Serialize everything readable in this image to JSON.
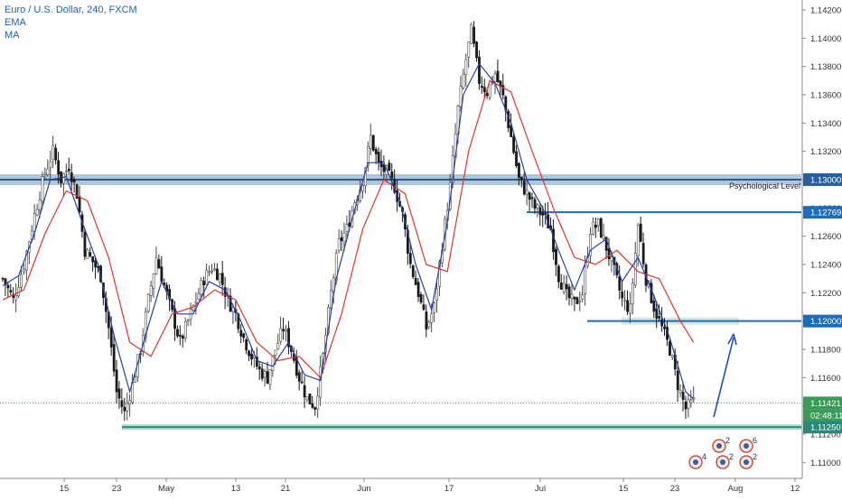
{
  "legend": {
    "symbol": "Euro / U.S. Dollar, 240, FXCM",
    "ema_label": "EMA",
    "ma_label": "MA"
  },
  "colors": {
    "candle_up": "#4a4a4a",
    "candle_down": "#1a1a1a",
    "ema_line": "#2a3ea8",
    "ma_line": "#e0362c",
    "resistance_band": "#1e5b99",
    "horizontal_line": "#1e6bb8",
    "support_band": "#2a8a7a",
    "zone_fill": "#cfe5dc",
    "arrow": "#1e4fb5",
    "price_dots": "#3a9a5a",
    "axis_text": "#333333"
  },
  "chart_data": {
    "type": "candlestick",
    "x_tick_labels": [
      "15",
      "23",
      "May",
      "13",
      "21",
      "Jun",
      "17",
      "Jul",
      "15",
      "23",
      "Aug",
      "12"
    ],
    "y_tick_labels": [
      "1.14200",
      "1.14000",
      "1.13800",
      "1.13600",
      "1.13400",
      "1.13200",
      "1.13000",
      "1.12800",
      "1.12600",
      "1.12400",
      "1.12200",
      "1.12000",
      "1.11800",
      "1.11600",
      "1.11400",
      "1.11200",
      "1.11000"
    ],
    "ylim": [
      1.109,
      1.1427
    ],
    "price_path": [
      [
        0,
        1.123
      ],
      [
        4,
        1.1215
      ],
      [
        8,
        1.124
      ],
      [
        12,
        1.1275
      ],
      [
        16,
        1.1305
      ],
      [
        19,
        1.132
      ],
      [
        22,
        1.13
      ],
      [
        25,
        1.131
      ],
      [
        28,
        1.129
      ],
      [
        31,
        1.125
      ],
      [
        34,
        1.1242
      ],
      [
        37,
        1.1232
      ],
      [
        40,
        1.1195
      ],
      [
        43,
        1.115
      ],
      [
        46,
        1.1135
      ],
      [
        49,
        1.1155
      ],
      [
        52,
        1.118
      ],
      [
        55,
        1.1215
      ],
      [
        58,
        1.1245
      ],
      [
        61,
        1.1225
      ],
      [
        64,
        1.1205
      ],
      [
        67,
        1.1185
      ],
      [
        70,
        1.12
      ],
      [
        73,
        1.1215
      ],
      [
        76,
        1.123
      ],
      [
        79,
        1.1238
      ],
      [
        82,
        1.1232
      ],
      [
        85,
        1.1215
      ],
      [
        88,
        1.1205
      ],
      [
        91,
        1.1188
      ],
      [
        94,
        1.1175
      ],
      [
        97,
        1.1165
      ],
      [
        100,
        1.116
      ],
      [
        103,
        1.118
      ],
      [
        106,
        1.1195
      ],
      [
        109,
        1.118
      ],
      [
        112,
        1.116
      ],
      [
        115,
        1.1145
      ],
      [
        118,
        1.114
      ],
      [
        121,
        1.1175
      ],
      [
        124,
        1.122
      ],
      [
        127,
        1.1255
      ],
      [
        130,
        1.1265
      ],
      [
        133,
        1.1285
      ],
      [
        136,
        1.13
      ],
      [
        139,
        1.133
      ],
      [
        142,
        1.131
      ],
      [
        145,
        1.1305
      ],
      [
        148,
        1.1295
      ],
      [
        151,
        1.1275
      ],
      [
        154,
        1.124
      ],
      [
        157,
        1.122
      ],
      [
        160,
        1.1195
      ],
      [
        163,
        1.121
      ],
      [
        166,
        1.1255
      ],
      [
        169,
        1.1295
      ],
      [
        172,
        1.135
      ],
      [
        175,
        1.1385
      ],
      [
        177,
        1.1405
      ],
      [
        180,
        1.137
      ],
      [
        183,
        1.1362
      ],
      [
        186,
        1.1375
      ],
      [
        189,
        1.1358
      ],
      [
        192,
        1.133
      ],
      [
        195,
        1.13
      ],
      [
        198,
        1.129
      ],
      [
        201,
        1.128
      ],
      [
        204,
        1.1275
      ],
      [
        207,
        1.1265
      ],
      [
        210,
        1.1232
      ],
      [
        213,
        1.1218
      ],
      [
        216,
        1.1212
      ],
      [
        219,
        1.122
      ],
      [
        222,
        1.1265
      ],
      [
        225,
        1.1268
      ],
      [
        228,
        1.1252
      ],
      [
        231,
        1.1235
      ],
      [
        234,
        1.1215
      ],
      [
        237,
        1.1208
      ],
      [
        240,
        1.1268
      ],
      [
        243,
        1.123
      ],
      [
        246,
        1.121
      ],
      [
        249,
        1.1195
      ],
      [
        252,
        1.118
      ],
      [
        255,
        1.1155
      ],
      [
        258,
        1.1138
      ],
      [
        261,
        1.1143
      ]
    ],
    "ema_series": [
      [
        0,
        1.1225
      ],
      [
        6,
        1.1232
      ],
      [
        12,
        1.1262
      ],
      [
        18,
        1.13
      ],
      [
        24,
        1.1302
      ],
      [
        30,
        1.127
      ],
      [
        36,
        1.124
      ],
      [
        42,
        1.119
      ],
      [
        48,
        1.115
      ],
      [
        54,
        1.119
      ],
      [
        60,
        1.1228
      ],
      [
        66,
        1.1205
      ],
      [
        72,
        1.1205
      ],
      [
        78,
        1.1228
      ],
      [
        84,
        1.1222
      ],
      [
        90,
        1.12
      ],
      [
        96,
        1.1172
      ],
      [
        102,
        1.1168
      ],
      [
        108,
        1.1185
      ],
      [
        114,
        1.1162
      ],
      [
        120,
        1.1158
      ],
      [
        126,
        1.123
      ],
      [
        132,
        1.1272
      ],
      [
        138,
        1.1312
      ],
      [
        144,
        1.1312
      ],
      [
        150,
        1.1285
      ],
      [
        156,
        1.124
      ],
      [
        162,
        1.1208
      ],
      [
        168,
        1.127
      ],
      [
        174,
        1.136
      ],
      [
        180,
        1.1382
      ],
      [
        186,
        1.1368
      ],
      [
        192,
        1.134
      ],
      [
        198,
        1.13
      ],
      [
        204,
        1.128
      ],
      [
        210,
        1.125
      ],
      [
        216,
        1.1222
      ],
      [
        222,
        1.125
      ],
      [
        228,
        1.1258
      ],
      [
        234,
        1.1228
      ],
      [
        240,
        1.1245
      ],
      [
        246,
        1.1218
      ],
      [
        252,
        1.1188
      ],
      [
        258,
        1.115
      ],
      [
        261,
        1.1145
      ]
    ],
    "ma_series": [
      [
        0,
        1.1215
      ],
      [
        8,
        1.1222
      ],
      [
        16,
        1.1262
      ],
      [
        24,
        1.1292
      ],
      [
        32,
        1.1285
      ],
      [
        40,
        1.1245
      ],
      [
        48,
        1.1185
      ],
      [
        56,
        1.1175
      ],
      [
        64,
        1.1205
      ],
      [
        72,
        1.121
      ],
      [
        80,
        1.1222
      ],
      [
        88,
        1.1215
      ],
      [
        96,
        1.1185
      ],
      [
        104,
        1.1172
      ],
      [
        112,
        1.1175
      ],
      [
        120,
        1.116
      ],
      [
        128,
        1.1205
      ],
      [
        136,
        1.1265
      ],
      [
        144,
        1.13
      ],
      [
        152,
        1.129
      ],
      [
        160,
        1.124
      ],
      [
        168,
        1.1235
      ],
      [
        176,
        1.132
      ],
      [
        184,
        1.137
      ],
      [
        192,
        1.1362
      ],
      [
        200,
        1.132
      ],
      [
        208,
        1.128
      ],
      [
        216,
        1.1245
      ],
      [
        224,
        1.124
      ],
      [
        232,
        1.125
      ],
      [
        240,
        1.1235
      ],
      [
        248,
        1.123
      ],
      [
        256,
        1.12
      ],
      [
        261,
        1.1185
      ]
    ],
    "annotations": {
      "resistance_level": {
        "price": 1.13,
        "label": "Psychological Level",
        "axis_label": "1.13000"
      },
      "line_1": {
        "price": 1.12769,
        "axis_label": "1.12769"
      },
      "line_2": {
        "price": 1.12,
        "axis_label": "1.12000"
      },
      "support_level": {
        "price": 1.1125,
        "axis_label": "1.11250"
      },
      "current_price": {
        "price": 1.11421,
        "axis_label": "1.11421",
        "countdown": "02:48:11"
      }
    },
    "event_badges": [
      "2",
      "6",
      "4",
      "2",
      "2"
    ]
  }
}
